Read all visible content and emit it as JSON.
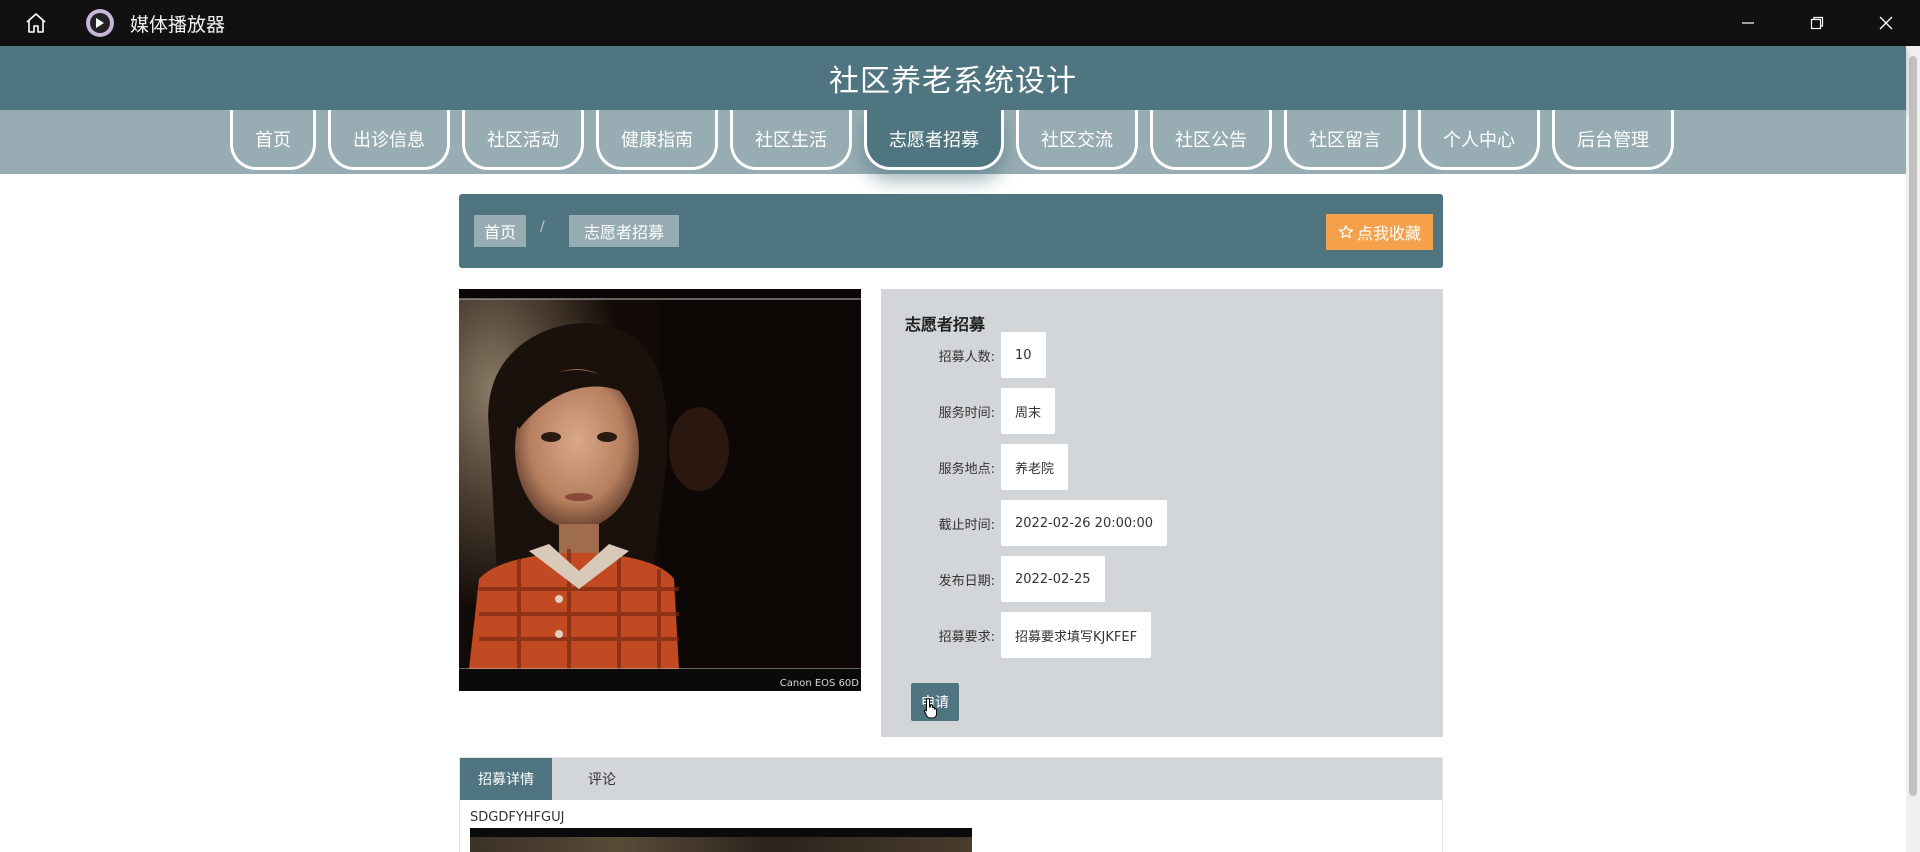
{
  "window": {
    "title": "媒体播放器"
  },
  "site": {
    "title": "社区养老系统设计"
  },
  "nav": {
    "items": [
      {
        "label": "首页"
      },
      {
        "label": "出诊信息"
      },
      {
        "label": "社区活动"
      },
      {
        "label": "健康指南"
      },
      {
        "label": "社区生活"
      },
      {
        "label": "志愿者招募",
        "active": true
      },
      {
        "label": "社区交流"
      },
      {
        "label": "社区公告"
      },
      {
        "label": "社区留言"
      },
      {
        "label": "个人中心"
      },
      {
        "label": "后台管理"
      }
    ]
  },
  "breadcrumb": {
    "home": "首页",
    "separator": "/",
    "current": "志愿者招募"
  },
  "favorite": {
    "icon": "star-outline-icon",
    "label": "点我收藏"
  },
  "photo": {
    "caption": "Canon EOS 60D"
  },
  "detail": {
    "title": "志愿者招募",
    "fields": [
      {
        "label": "招募人数:",
        "value": "10"
      },
      {
        "label": "服务时间:",
        "value": "周末"
      },
      {
        "label": "服务地点:",
        "value": "养老院"
      },
      {
        "label": "截止时间:",
        "value": "2022-02-26 20:00:00"
      },
      {
        "label": "发布日期:",
        "value": "2022-02-25"
      },
      {
        "label": "招募要求:",
        "value": "招募要求填写KJKFEF"
      }
    ],
    "apply_label": "申请"
  },
  "tabs": {
    "items": [
      {
        "label": "招募详情",
        "active": true
      },
      {
        "label": "评论"
      }
    ],
    "content_text": "SDGDFYHFGUJ"
  },
  "colors": {
    "primary": "#4f7580",
    "nav_bg": "#97adb3",
    "accent": "#f5a04a",
    "panel_bg": "#d3d6d8"
  }
}
